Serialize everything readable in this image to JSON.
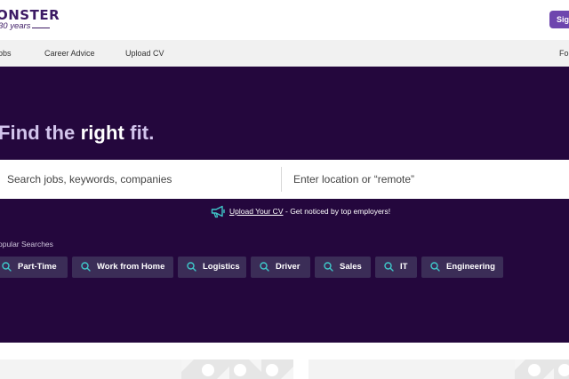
{
  "header": {
    "logo_word": "ONSTER",
    "logo_years": "30 years",
    "signin_label": "Sign"
  },
  "nav": {
    "items": [
      {
        "label": "obs"
      },
      {
        "label": "Career Advice"
      },
      {
        "label": "Upload CV"
      },
      {
        "label": "Fo"
      }
    ]
  },
  "hero": {
    "headline_pre": "Find the ",
    "headline_strong": "right",
    "headline_post": " fit.",
    "search": {
      "jobs_placeholder": "Search jobs, keywords, companies",
      "location_placeholder": "Enter location or “remote”"
    },
    "upload": {
      "link_label": "Upload Your CV",
      "text": " - Get noticed by top employers!"
    },
    "popular_label": "opular Searches",
    "chips": [
      {
        "label": "Part-Time"
      },
      {
        "label": "Work from Home"
      },
      {
        "label": "Logistics"
      },
      {
        "label": "Driver"
      },
      {
        "label": "Sales"
      },
      {
        "label": "IT"
      },
      {
        "label": "Engineering"
      }
    ]
  },
  "colors": {
    "brand_purple": "#6e46ae",
    "hero_bg": "#24073d",
    "chip_bg": "#3b2d57",
    "accent_teal": "#3fc7c9"
  }
}
